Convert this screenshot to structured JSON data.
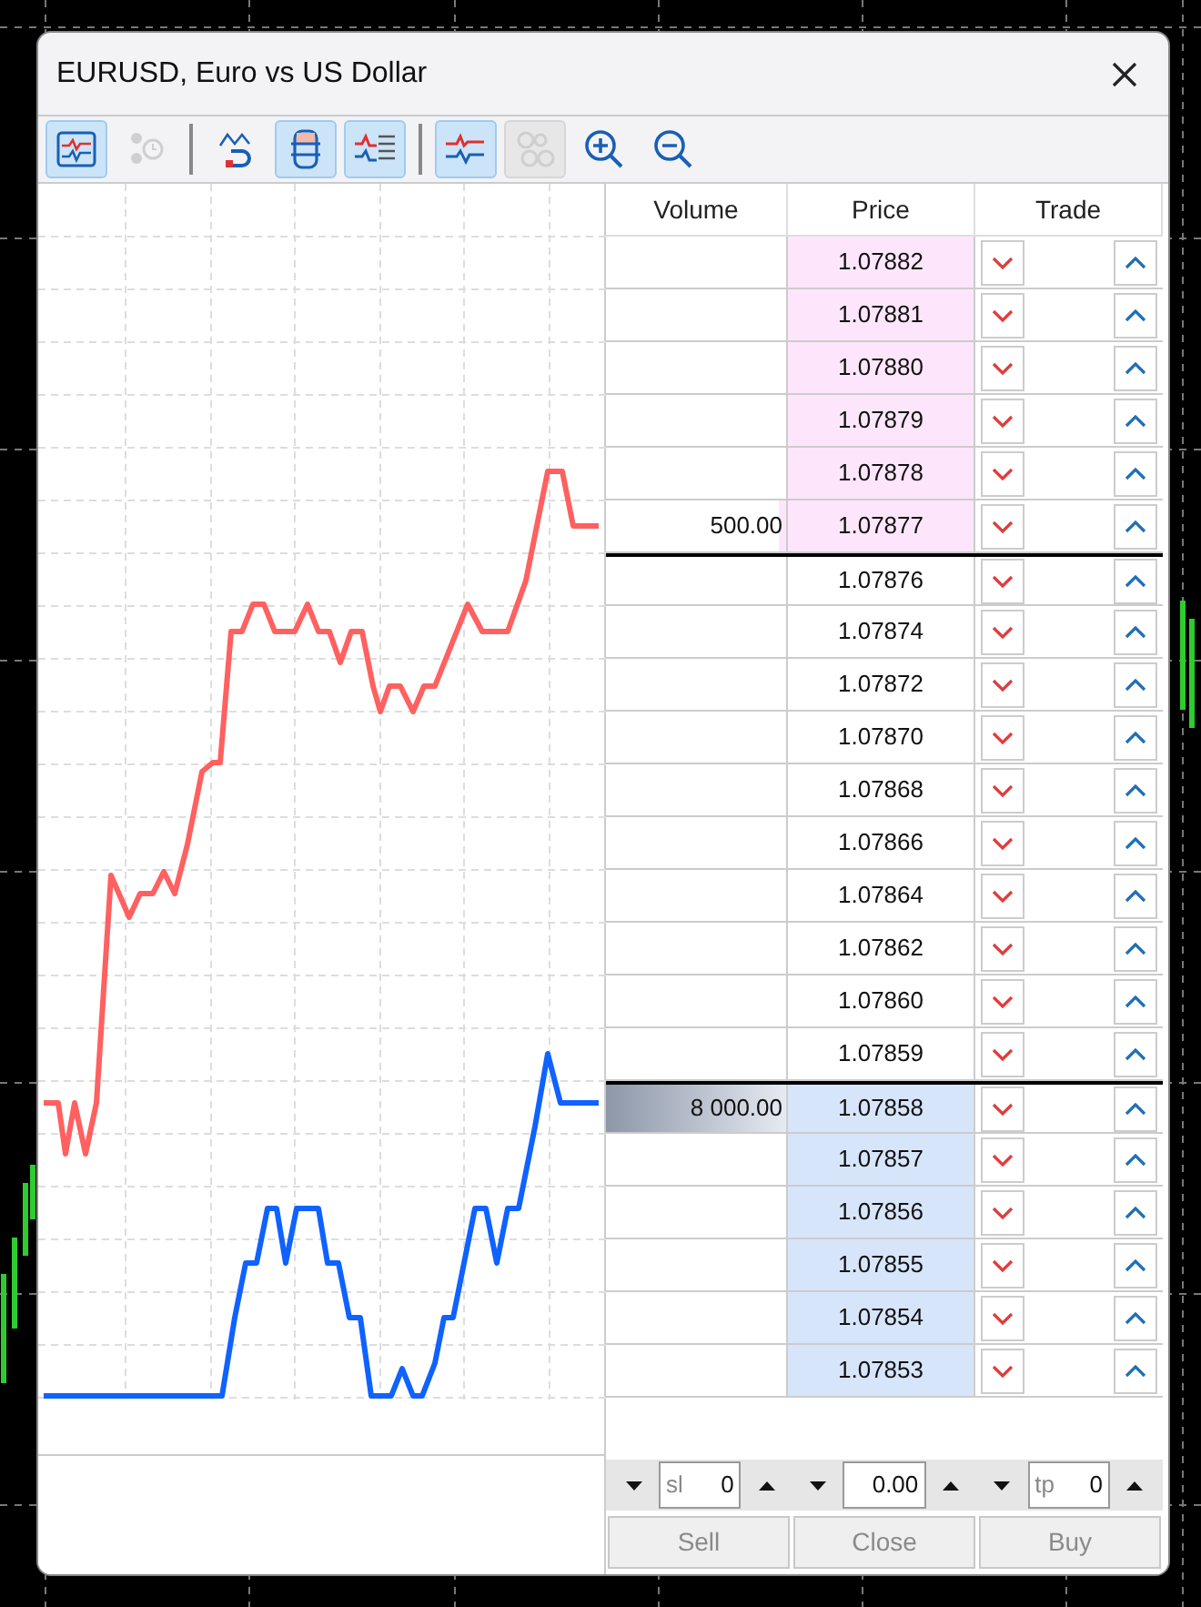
{
  "window": {
    "title": "EURUSD, Euro vs US Dollar"
  },
  "toolbar": [
    {
      "kind": "chart",
      "selected": true,
      "disabled": false
    },
    {
      "kind": "history",
      "selected": false,
      "disabled": true
    },
    {
      "kind": "separator"
    },
    {
      "kind": "magnet",
      "selected": false,
      "disabled": false
    },
    {
      "kind": "depth",
      "selected": true,
      "disabled": false
    },
    {
      "kind": "ticks",
      "selected": true,
      "disabled": false
    },
    {
      "kind": "separator"
    },
    {
      "kind": "lines",
      "selected": true,
      "disabled": false
    },
    {
      "kind": "bubbles",
      "selected": true,
      "disabled": true
    },
    {
      "kind": "zoom-in",
      "selected": false,
      "disabled": false
    },
    {
      "kind": "zoom-out",
      "selected": false,
      "disabled": false
    }
  ],
  "columns": [
    "Volume",
    "Price",
    "Trade"
  ],
  "rows": [
    {
      "price": "1.07882",
      "kind": "ask"
    },
    {
      "price": "1.07881",
      "kind": "ask"
    },
    {
      "price": "1.07880",
      "kind": "ask"
    },
    {
      "price": "1.07879",
      "kind": "ask"
    },
    {
      "price": "1.07878",
      "kind": "ask"
    },
    {
      "price": "1.07877",
      "kind": "ask",
      "volume": "500.00",
      "level": 0.04
    },
    {
      "price": "1.07876",
      "kind": "plain"
    },
    {
      "price": "1.07874",
      "kind": "plain"
    },
    {
      "price": "1.07872",
      "kind": "plain"
    },
    {
      "price": "1.07870",
      "kind": "plain"
    },
    {
      "price": "1.07868",
      "kind": "plain"
    },
    {
      "price": "1.07866",
      "kind": "plain"
    },
    {
      "price": "1.07864",
      "kind": "plain"
    },
    {
      "price": "1.07862",
      "kind": "plain"
    },
    {
      "price": "1.07860",
      "kind": "plain"
    },
    {
      "price": "1.07859",
      "kind": "plain"
    },
    {
      "price": "1.07858",
      "kind": "bid",
      "volume": "8 000.00",
      "level": 1
    },
    {
      "price": "1.07857",
      "kind": "bid"
    },
    {
      "price": "1.07856",
      "kind": "bid"
    },
    {
      "price": "1.07855",
      "kind": "bid"
    },
    {
      "price": "1.07854",
      "kind": "bid"
    },
    {
      "price": "1.07853",
      "kind": "bid"
    }
  ],
  "spinners": [
    {
      "prefix": "sl",
      "value": "0"
    },
    {
      "value": "0.00"
    },
    {
      "prefix": "tp",
      "value": "0"
    }
  ],
  "buttons": [
    {
      "label": "Sell",
      "disabled": true
    },
    {
      "label": "Close",
      "disabled": true
    },
    {
      "label": "Buy",
      "disabled": true
    }
  ]
}
